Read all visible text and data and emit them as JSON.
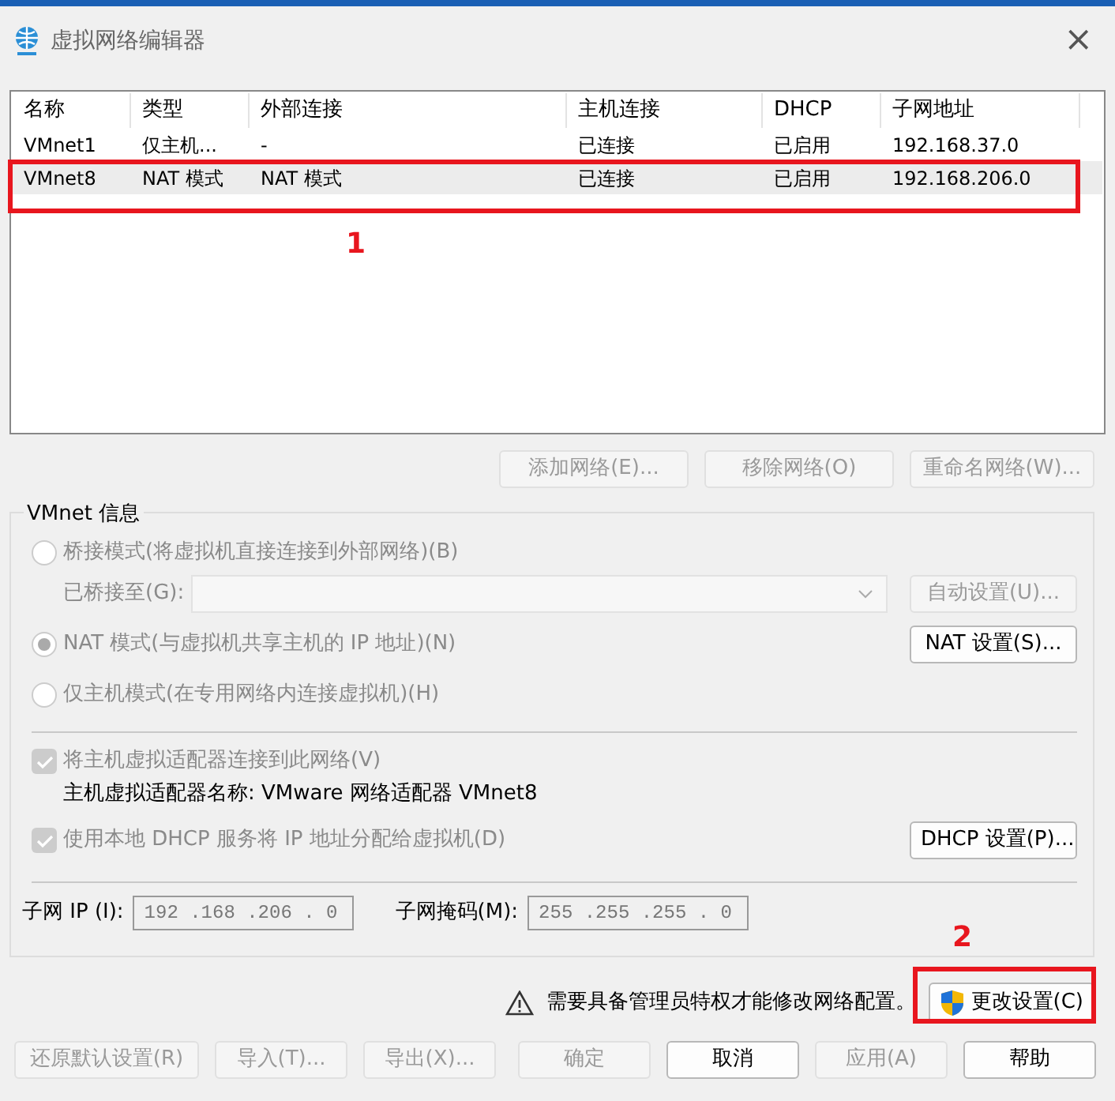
{
  "window": {
    "title": "虚拟网络编辑器",
    "close": "×"
  },
  "table": {
    "columns": [
      "名称",
      "类型",
      "外部连接",
      "主机连接",
      "DHCP",
      "子网地址"
    ],
    "rows": [
      {
        "cells": [
          "VMnet1",
          "仅主机...",
          "-",
          "已连接",
          "已启用",
          "192.168.37.0"
        ],
        "selected": false
      },
      {
        "cells": [
          "VMnet8",
          "NAT 模式",
          "NAT 模式",
          "已连接",
          "已启用",
          "192.168.206.0"
        ],
        "selected": true
      }
    ]
  },
  "list_buttons": [
    {
      "label": "添加网络(E)...",
      "disabled": true
    },
    {
      "label": "移除网络(O)",
      "disabled": true
    },
    {
      "label": "重命名网络(W)...",
      "disabled": true
    }
  ],
  "vmnet_info": {
    "title": "VMnet 信息",
    "modes": [
      {
        "kind": "radio",
        "label": "桥接模式(将虚拟机直接连接到外部网络)(B)",
        "selected": false,
        "disabled": true
      },
      {
        "kind": "bridge",
        "label": "已桥接至(G):",
        "disabled": true,
        "button": {
          "label": "自动设置(U)...",
          "disabled": true
        }
      },
      {
        "kind": "radio",
        "label": "NAT 模式(与虚拟机共享主机的 IP 地址)(N)",
        "selected": true,
        "disabled": true,
        "button": {
          "label": "NAT 设置(S)...",
          "disabled": false
        }
      },
      {
        "kind": "radio",
        "label": "仅主机模式(在专用网络内连接虚拟机)(H)",
        "selected": false,
        "disabled": true
      }
    ],
    "options": [
      {
        "kind": "checkbox",
        "label": "将主机虚拟适配器连接到此网络(V)",
        "checked": true,
        "disabled": true
      },
      {
        "kind": "text",
        "label": "主机虚拟适配器名称: VMware 网络适配器 VMnet8"
      },
      {
        "kind": "checkbox",
        "label": "使用本地 DHCP 服务将 IP 地址分配给虚拟机(D)",
        "checked": true,
        "disabled": true,
        "button": {
          "label": "DHCP 设置(P)...",
          "disabled": false
        }
      }
    ],
    "subnet_ip": {
      "label": "子网 IP (I):",
      "value": "192 .168 .206 . 0"
    },
    "subnet_mask": {
      "label": "子网掩码(M):",
      "value": "255 .255 .255 . 0"
    }
  },
  "admin_notice": {
    "text": "需要具备管理员特权才能修改网络配置。",
    "button": "更改设置(C)"
  },
  "footer_buttons": [
    {
      "label": "还原默认设置(R)",
      "disabled": true
    },
    {
      "label": "导入(T)...",
      "disabled": true
    },
    {
      "label": "导出(X)...",
      "disabled": true
    },
    {
      "label": "确定",
      "disabled": true
    },
    {
      "label": "取消",
      "disabled": false
    },
    {
      "label": "应用(A)",
      "disabled": true
    },
    {
      "label": "帮助",
      "disabled": false
    }
  ],
  "annotations": [
    {
      "label": "1"
    },
    {
      "label": "2"
    }
  ]
}
